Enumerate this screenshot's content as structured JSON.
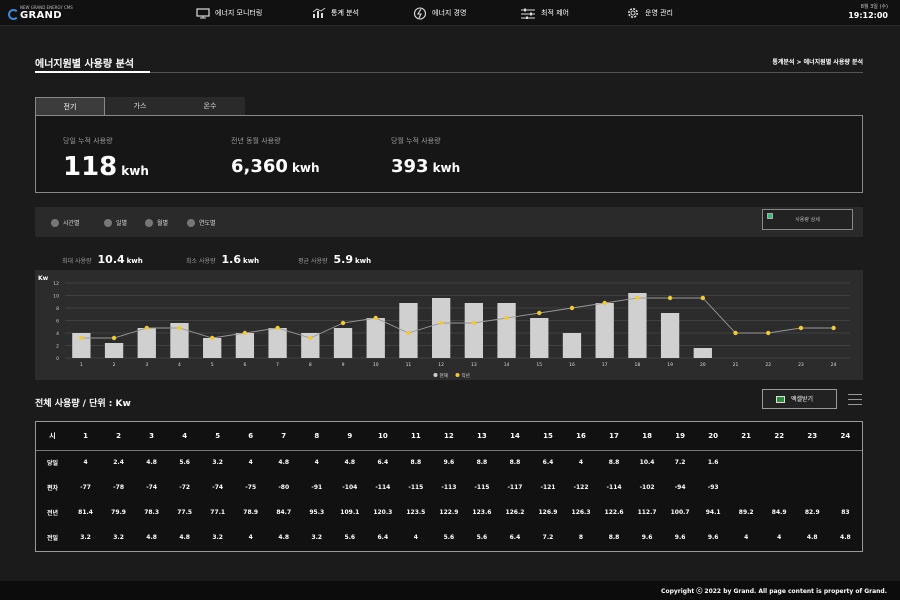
{
  "header": {
    "logo_sub": "NEW GRAND ENERGY CMS",
    "logo_name": "GRAND",
    "nav": [
      {
        "label": "에너지 모니터링",
        "icon": "monitor-icon"
      },
      {
        "label": "통계 분석",
        "icon": "bar-chart-icon"
      },
      {
        "label": "에너지 경영",
        "icon": "energy-icon"
      },
      {
        "label": "최적 제어",
        "icon": "sliders-icon"
      },
      {
        "label": "운영 관리",
        "icon": "gear-icon"
      }
    ],
    "date": "8월 3일 (수)",
    "time": "19:12:00"
  },
  "page": {
    "title": "에너지원별 사용량 분석",
    "breadcrumb": "통계분석 > 에너지원별 사용량 분석"
  },
  "tabs": [
    {
      "label": "전기",
      "active": true
    },
    {
      "label": "가스",
      "active": false
    },
    {
      "label": "온수",
      "active": false
    }
  ],
  "summary": [
    {
      "label": "당일 누적 사용량",
      "value": "118",
      "unit": "kwh"
    },
    {
      "label": "전년 동월 사용량",
      "value": "6,360",
      "unit": "kwh"
    },
    {
      "label": "당월 누적 사용량",
      "value": "393",
      "unit": "kwh"
    }
  ],
  "filters": [
    "시간별",
    "일별",
    "월별",
    "연도별"
  ],
  "detail_button": "사용량 상세",
  "stats": [
    {
      "label": "최대 사용량",
      "value": "10.4",
      "unit": "kwh"
    },
    {
      "label": "최소 사용량",
      "value": "1.6",
      "unit": "kwh"
    },
    {
      "label": "평균 사용량",
      "value": "5.9",
      "unit": "kwh"
    }
  ],
  "chart_data": {
    "type": "bar",
    "ylabel": "Kw",
    "ylim": [
      0,
      12
    ],
    "yticks": [
      0,
      2,
      4,
      6,
      8,
      10,
      12
    ],
    "categories": [
      "1",
      "2",
      "3",
      "4",
      "5",
      "6",
      "7",
      "8",
      "9",
      "10",
      "11",
      "12",
      "13",
      "14",
      "15",
      "16",
      "17",
      "18",
      "19",
      "20",
      "21",
      "22",
      "23",
      "24"
    ],
    "series": [
      {
        "name": "현재",
        "type": "bar",
        "color": "#d0d0d0",
        "values": [
          4,
          2.4,
          4.8,
          5.6,
          3.2,
          4,
          4.8,
          4,
          4.8,
          6.4,
          8.8,
          9.6,
          8.8,
          8.8,
          6.4,
          4,
          8.8,
          10.4,
          7.2,
          1.6,
          null,
          null,
          null,
          null
        ]
      },
      {
        "name": "작년",
        "type": "line",
        "color": "#f0c93a",
        "values": [
          3.2,
          3.2,
          4.8,
          4.8,
          3.2,
          4,
          4.8,
          3.2,
          5.6,
          6.4,
          4,
          5.6,
          5.6,
          6.4,
          7.2,
          8,
          8.8,
          9.6,
          9.6,
          9.6,
          4,
          4,
          4.8,
          4.8
        ]
      }
    ],
    "grid": true,
    "legend": "bottom-center"
  },
  "table_section": {
    "title": "전체 사용량 / 단위 : Kw",
    "excel_label": "엑셀받기"
  },
  "table": {
    "headers": [
      "시",
      "1",
      "2",
      "3",
      "4",
      "5",
      "6",
      "7",
      "8",
      "9",
      "10",
      "11",
      "12",
      "13",
      "14",
      "15",
      "16",
      "17",
      "18",
      "19",
      "20",
      "21",
      "22",
      "23",
      "24"
    ],
    "rows": [
      [
        "당일",
        "4",
        "2.4",
        "4.8",
        "5.6",
        "3.2",
        "4",
        "4.8",
        "4",
        "4.8",
        "6.4",
        "8.8",
        "9.6",
        "8.8",
        "8.8",
        "6.4",
        "4",
        "8.8",
        "10.4",
        "7.2",
        "1.6",
        "",
        "",
        "",
        ""
      ],
      [
        "편차",
        "-77",
        "-78",
        "-74",
        "-72",
        "-74",
        "-75",
        "-80",
        "-91",
        "-104",
        "-114",
        "-115",
        "-113",
        "-115",
        "-117",
        "-121",
        "-122",
        "-114",
        "-102",
        "-94",
        "-93",
        "",
        "",
        "",
        ""
      ],
      [
        "전년",
        "81.4",
        "79.9",
        "78.3",
        "77.5",
        "77.1",
        "78.9",
        "84.7",
        "95.3",
        "109.1",
        "120.3",
        "123.5",
        "122.9",
        "123.6",
        "126.2",
        "126.9",
        "126.3",
        "122.6",
        "112.7",
        "100.7",
        "94.1",
        "89.2",
        "84.9",
        "82.9",
        "83"
      ],
      [
        "전일",
        "3.2",
        "3.2",
        "4.8",
        "4.8",
        "3.2",
        "4",
        "4.8",
        "3.2",
        "5.6",
        "6.4",
        "4",
        "5.6",
        "5.6",
        "6.4",
        "7.2",
        "8",
        "8.8",
        "9.6",
        "9.6",
        "9.6",
        "4",
        "4",
        "4.8",
        "4.8"
      ]
    ]
  },
  "footer": "Copyright ⓒ 2022 by Grand. All page content is property of Grand."
}
